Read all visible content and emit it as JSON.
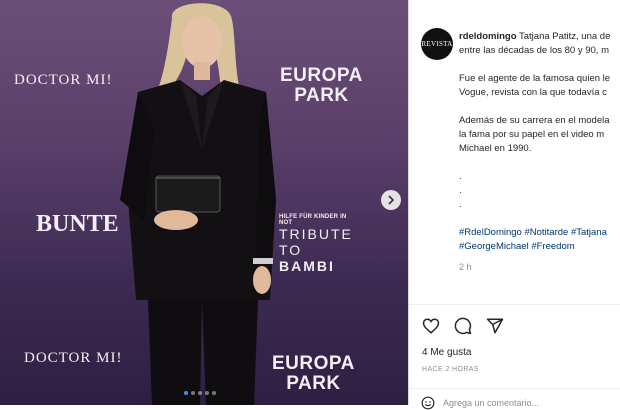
{
  "media": {
    "wall": {
      "doctor_top": "DOCTOR MI!",
      "europa_top_1": "EUROPA",
      "europa_top_2": "PARK",
      "bunte": "BUNTE",
      "bambi_small": "HILFE FÜR KINDER IN NOT",
      "bambi_1": "TRIBUTE TO",
      "bambi_2": "BAMBI",
      "doctor_bottom": "DOCTOR MI!",
      "europa_bottom_1": "EUROPA",
      "europa_bottom_2": "PARK"
    },
    "carousel_dots": 5,
    "active_dot": 0
  },
  "post": {
    "avatar_text": "REVISTA",
    "username": "rdeldomingo",
    "caption_line1": "Tatjana Patitz, una de",
    "caption_line2": "entre las décadas de los 80 y 90, m",
    "para2_line1": "Fue el agente de la famosa quien le",
    "para2_line2": "Vogue, revista con la que todavía c",
    "para3_line1": "Además de su carrera en el modela",
    "para3_line2": "la fama por su papel en el video m",
    "para3_line3": "Michael en 1990.",
    "dot1": ".",
    "dot2": ".",
    "dot3": ".",
    "hashtags_line1": "#RdelDomingo #Notitarde #Tatjana",
    "hashtags_line2": "#GeorgeMichael #Freedom",
    "caption_time": "2 h",
    "likes": "4 Me gusta",
    "time_ago": "HACE 2 HORAS",
    "comment_placeholder": "Agrega un comentario..."
  },
  "icons": [
    "heart-icon",
    "comment-icon",
    "share-icon",
    "chevron-right-icon",
    "emoji-icon"
  ]
}
